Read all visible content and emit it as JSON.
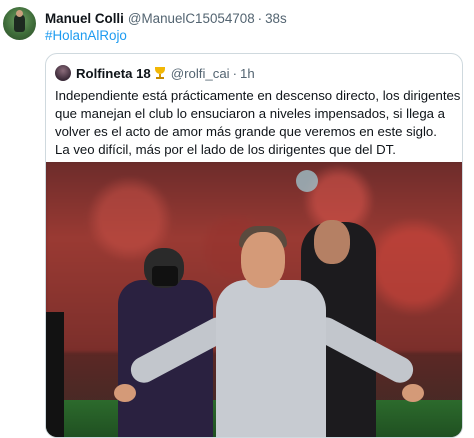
{
  "tweet": {
    "author_name": "Manuel Colli",
    "author_handle": "@ManuelC15054708",
    "separator": "·",
    "time": "38s",
    "hashtag": "#HolanAlRojo"
  },
  "quoted_tweet": {
    "author_name": "Rolfineta 18",
    "author_handle": "@rolfi_cai",
    "separator": "·",
    "time": "1h",
    "text_lines": [
      "Independiente está prácticamente en descenso directo, los dirigentes",
      "que manejan el club lo ensuciaron a niveles impensados, si llega a",
      "volver es el acto de amor más grande que veremos en este siglo.",
      "La veo difícil, más por el lado de los dirigentes que del DT."
    ]
  },
  "icons": {
    "badge": "trophy-icon",
    "author_avatar": "avatar",
    "quoted_avatar": "avatar"
  },
  "colors": {
    "link": "#1d9bf0",
    "secondary_text": "#536471",
    "border": "#cfd9de"
  }
}
